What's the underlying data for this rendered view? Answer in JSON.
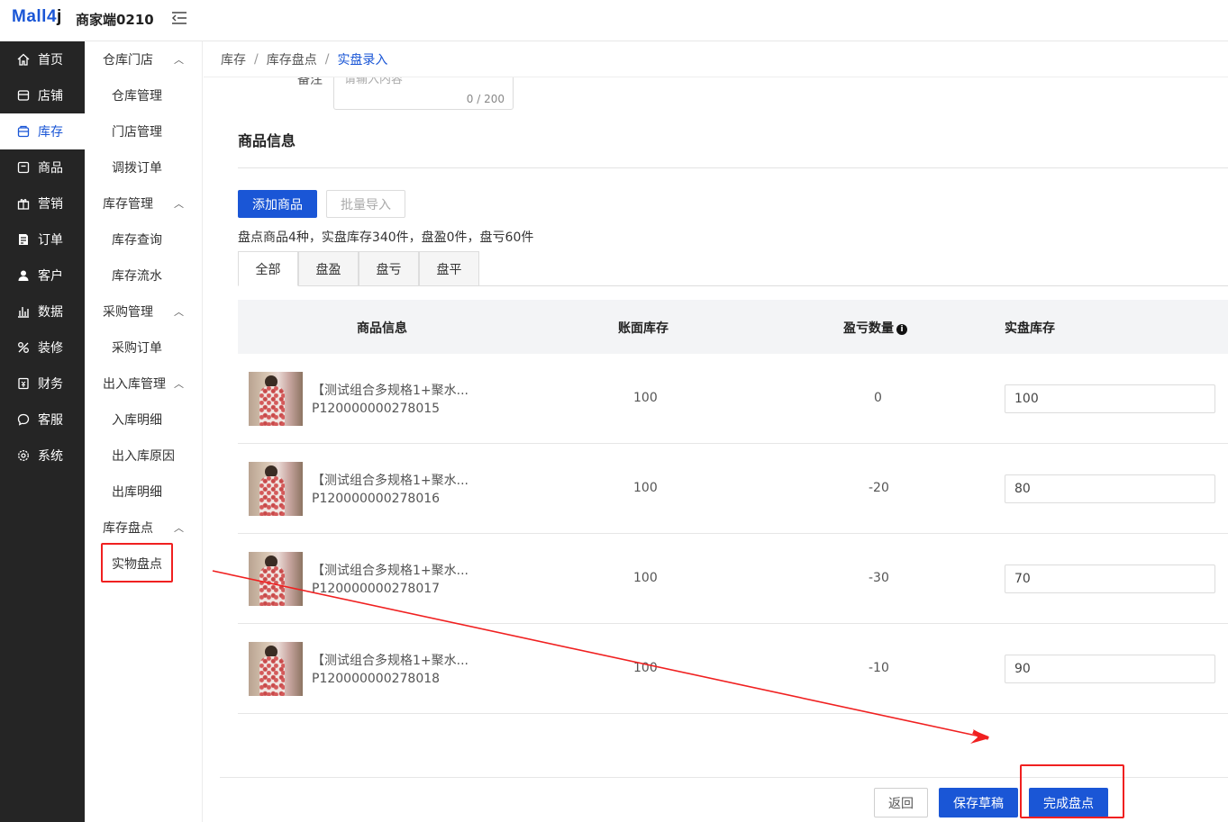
{
  "header": {
    "logo_main": "Mall4",
    "logo_j": "j",
    "shop_name": "商家端0210"
  },
  "sidebar": {
    "items": [
      {
        "label": "首页",
        "icon": "home-icon"
      },
      {
        "label": "店铺",
        "icon": "store-icon"
      },
      {
        "label": "库存",
        "icon": "inventory-icon",
        "active": true
      },
      {
        "label": "商品",
        "icon": "product-icon"
      },
      {
        "label": "营销",
        "icon": "gift-icon"
      },
      {
        "label": "订单",
        "icon": "order-icon"
      },
      {
        "label": "客户",
        "icon": "user-icon"
      },
      {
        "label": "数据",
        "icon": "chart-icon"
      },
      {
        "label": "装修",
        "icon": "decorate-icon"
      },
      {
        "label": "财务",
        "icon": "finance-icon"
      },
      {
        "label": "客服",
        "icon": "chat-icon"
      },
      {
        "label": "系统",
        "icon": "settings-icon"
      }
    ]
  },
  "submenu": {
    "group_warehouse": "仓库门店",
    "warehouse_mgmt": "仓库管理",
    "store_mgmt": "门店管理",
    "transfer_order": "调拨订单",
    "group_stock": "库存管理",
    "stock_query": "库存查询",
    "stock_flow": "库存流水",
    "group_purchase": "采购管理",
    "purchase_order": "采购订单",
    "group_inout": "出入库管理",
    "in_detail": "入库明细",
    "inout_reason": "出入库原因",
    "out_detail": "出库明细",
    "group_check": "库存盘点",
    "physical_check": "实物盘点"
  },
  "breadcrumb": {
    "level1": "库存",
    "level2": "库存盘点",
    "level3": "实盘录入",
    "sep": "/"
  },
  "remark": {
    "label": "备注",
    "placeholder": "请输入内容",
    "counter": "0 / 200"
  },
  "product_section": {
    "title": "商品信息",
    "add_button": "添加商品",
    "import_button": "批量导入",
    "summary": "盘点商品4种，实盘库存340件，盘盈0件，盘亏60件"
  },
  "tabs": [
    "全部",
    "盘盈",
    "盘亏",
    "盘平"
  ],
  "table": {
    "headers": {
      "product": "商品信息",
      "book_stock": "账面库存",
      "diff": "盈亏数量",
      "actual": "实盘库存"
    },
    "rows": [
      {
        "name": "【测试组合多规格1+聚水...",
        "code": "P120000000278015",
        "book": "100",
        "diff": "0",
        "actual": "100"
      },
      {
        "name": "【测试组合多规格1+聚水...",
        "code": "P120000000278016",
        "book": "100",
        "diff": "-20",
        "actual": "80"
      },
      {
        "name": "【测试组合多规格1+聚水...",
        "code": "P120000000278017",
        "book": "100",
        "diff": "-30",
        "actual": "70"
      },
      {
        "name": "【测试组合多规格1+聚水...",
        "code": "P120000000278018",
        "book": "100",
        "diff": "-10",
        "actual": "90"
      }
    ]
  },
  "footer": {
    "back": "返回",
    "save_draft": "保存草稿",
    "finish": "完成盘点"
  },
  "colors": {
    "primary": "#1a56d6",
    "sidebar_bg": "#252525",
    "annotation_red": "#f02020"
  }
}
